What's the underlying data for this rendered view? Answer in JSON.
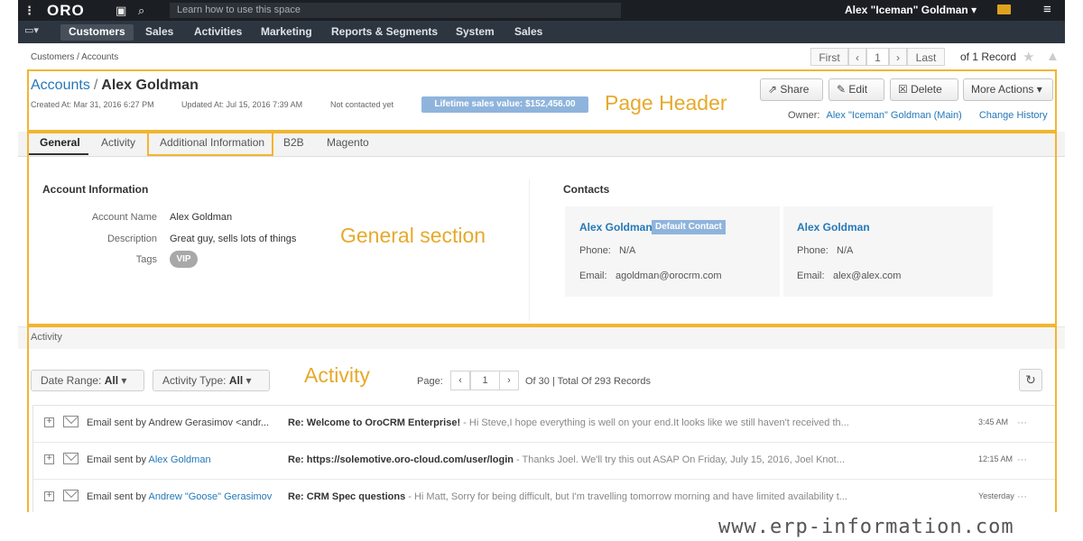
{
  "topbar": {
    "brand": "ORO",
    "search_placeholder": "Learn how to use this space",
    "user": "Alex \"Iceman\" Goldman ▾"
  },
  "nav": {
    "items": [
      "Customers",
      "Sales",
      "Activities",
      "Marketing",
      "Reports & Segments",
      "System",
      "Sales"
    ],
    "active": "Customers"
  },
  "breadcrumb": "Customers / Accounts",
  "pager": {
    "first": "First",
    "prev": "‹",
    "page": "1",
    "next": "›",
    "last": "Last",
    "count": "of 1 Record"
  },
  "header": {
    "crumb": "Accounts",
    "separator": "/",
    "name": "Alex Goldman",
    "created": "Created At: Mar 31, 2016 6:27 PM",
    "updated": "Updated At: Jul 15, 2016 7:39 AM",
    "contacted": "Not contacted yet",
    "lifetime": "Lifetime sales value: $152,456.00",
    "buttons": {
      "share": "⇗ Share",
      "edit": "✎ Edit",
      "delete": "☒ Delete",
      "more": "More Actions ▾"
    },
    "owner_label": "Owner:",
    "owner": "Alex \"Iceman\" Goldman (Main)",
    "history": "Change History"
  },
  "annotations": {
    "page_header": "Page Header",
    "general": "General section",
    "activity": "Activity"
  },
  "tabs": [
    "General",
    "Activity",
    "Additional Information",
    "B2B",
    "Magento"
  ],
  "general": {
    "account_title": "Account Information",
    "account_name_label": "Account Name",
    "account_name": "Alex Goldman",
    "description_label": "Description",
    "description": "Great guy, sells lots of things",
    "tags_label": "Tags",
    "tag": "VIP"
  },
  "contacts": {
    "title": "Contacts",
    "items": [
      {
        "name": "Alex Goldman",
        "badge": "Default Contact",
        "phone_label": "Phone:",
        "phone": "N/A",
        "email_label": "Email:",
        "email": "agoldman@orocrm.com"
      },
      {
        "name": "Alex Goldman",
        "phone_label": "Phone:",
        "phone": "N/A",
        "email_label": "Email:",
        "email": "alex@alex.com"
      }
    ]
  },
  "activity": {
    "heading": "Activity",
    "date_range": "Date Range:",
    "date_value": "All",
    "type": "Activity Type:",
    "type_value": "All",
    "page_label": "Page:",
    "page": "1",
    "records": "Of 30 | Total Of 293 Records",
    "refresh_icon": "↻",
    "rows": [
      {
        "sent": "Email sent by Andrew Gerasimov <andr...",
        "sender": "",
        "subject": "Re: Welcome to OroCRM Enterprise!",
        "snippet": " - Hi Steve,I hope everything is well on your end.It looks like we still haven't received th...",
        "time": "3:45 AM"
      },
      {
        "sent": "Email sent by ",
        "sender": "Alex Goldman",
        "subject": "Re: https://solemotive.oro-cloud.com/user/login",
        "snippet": " - Thanks Joel. We'll try this out ASAP On Friday, July 15, 2016, Joel Knot...",
        "time": "12:15 AM"
      },
      {
        "sent": "Email sent by ",
        "sender": "Andrew \"Goose\" Gerasimov",
        "subject": "Re: CRM Spec questions",
        "snippet": " - Hi Matt, Sorry for being difficult, but I'm travelling tomorrow morning and have limited availability t...",
        "time": "Yesterday"
      }
    ],
    "more_icon": "···",
    "expand_icon": "+"
  },
  "watermark": "www.erp-information.com",
  "colors": {
    "accent": "#2578b8",
    "annotation": "#f2b530",
    "badge": "#8fb4dc",
    "topbar": "#1b1f24"
  }
}
